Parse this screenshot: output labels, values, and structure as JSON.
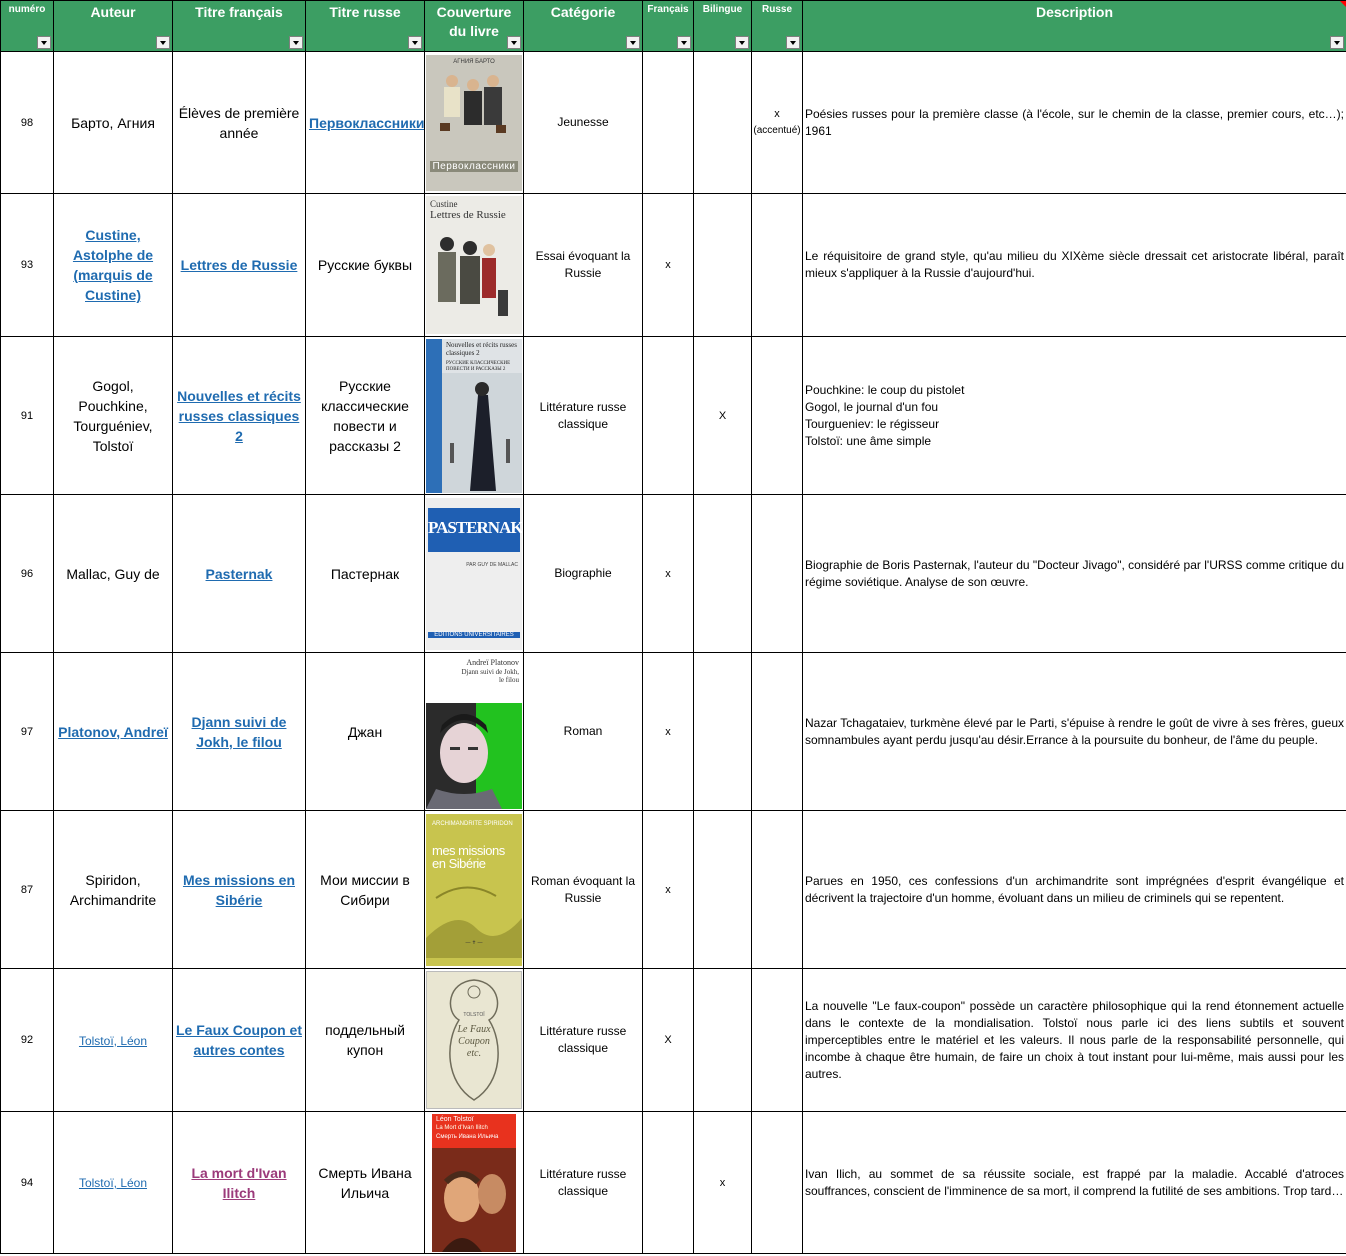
{
  "headers": {
    "numero": "numéro",
    "auteur": "Auteur",
    "titre_fr": "Titre français",
    "titre_ru": "Titre russe",
    "couverture_l1": "Couverture",
    "couverture_l2": "du livre",
    "categorie": "Catégorie",
    "francais": "Français",
    "bilingue": "Bilingue",
    "russe": "Russe",
    "description": "Description"
  },
  "colors": {
    "header_bg": "#3c9e63",
    "link": "#1f6bb0",
    "visited_link": "#9b3a7a"
  },
  "rows": [
    {
      "num": "98",
      "author": "Барто, Агния",
      "author_link": false,
      "title_fr": "Élèves de première année",
      "title_fr_link": false,
      "title_ru": "Первоклассники",
      "title_ru_link": true,
      "cover_text": "Первоклассники",
      "cover_top": "АГНИЯ БАРТО",
      "category": "Jeunesse",
      "fr": "",
      "bi": "",
      "ru": "x",
      "ru2": "(accentué)",
      "desc": "Poésies russes pour la première classe (à l'école, sur le chemin de la classe, premier cours, etc…); 1961"
    },
    {
      "num": "93",
      "author": "Custine, Astolphe de (marquis de Custine)",
      "author_link": true,
      "title_fr": "Lettres de Russie",
      "title_fr_link": true,
      "title_ru": "Русские буквы",
      "title_ru_link": false,
      "cover_text": "Custine",
      "cover_top": "Lettres de Russie",
      "category": "Essai évoquant la Russie",
      "fr": "x",
      "bi": "",
      "ru": "",
      "desc": "Le réquisitoire de grand style, qu'au milieu du XIXème siècle dressait cet aristocrate libéral, paraît mieux s'appliquer à la Russie d'aujourd'hui."
    },
    {
      "num": "91",
      "author": "Gogol, Pouchkine, Tourguéniev, Tolstoï",
      "author_link": false,
      "title_fr": "Nouvelles et récits russes classiques 2",
      "title_fr_link": true,
      "title_ru": "Русские классические повести и рассказы 2",
      "title_ru_link": false,
      "cover_text": "Nouvelles et récits russes classiques 2",
      "cover_top": "РУССКИЕ КЛАССИЧЕСКИЕ ПОВЕСТИ И РАССКАЗЫ 2",
      "category": "Littérature russe classique",
      "fr": "",
      "bi": "X",
      "ru": "",
      "desc_lines": [
        "Pouchkine: le coup du pistolet",
        "Gogol, le journal d'un fou",
        "Tourgueniev: le régisseur",
        "Tolstoï: une âme simple"
      ]
    },
    {
      "num": "96",
      "author": "Mallac, Guy de",
      "author_link": false,
      "title_fr": "Pasternak",
      "title_fr_link": true,
      "title_ru": "Пастернак",
      "title_ru_link": false,
      "cover_text": "PASTERNAK",
      "cover_sub": "PAR GUY DE MALLAC",
      "cover_bottom": "ÉDITIONS UNIVERSITAIRES",
      "category": "Biographie",
      "fr": "x",
      "bi": "",
      "ru": "",
      "desc": "Biographie de Boris Pasternak, l'auteur du \"Docteur Jivago\", considéré par l'URSS comme critique du régime soviétique. Analyse de son œuvre."
    },
    {
      "num": "97",
      "author": "Platonov, Andreï",
      "author_link": true,
      "title_fr": "Djann suivi de Jokh, le filou",
      "title_fr_link": true,
      "title_ru": "Джан",
      "title_ru_link": false,
      "cover_text": "Andreï Platonov",
      "cover_sub": "Djann suivi de Jokh, le filou",
      "category": "Roman",
      "fr": "x",
      "bi": "",
      "ru": "",
      "desc": "Nazar Tchagataiev, turkmène élevé par le Parti, s'épuise à rendre le goût de vivre à ses frères, gueux somnambules ayant perdu jusqu'au désir.Errance à la poursuite du bonheur, de l'âme du peuple."
    },
    {
      "num": "87",
      "author": "Spiridon, Archimandrite",
      "author_link": false,
      "title_fr": "Mes missions en Sibérie",
      "title_fr_link": true,
      "title_ru": "Мои миссии в Сибири",
      "title_ru_link": false,
      "cover_text": "ARCHIMANDRITE SPIRIDON",
      "cover_sub": "mes missions en Sibérie",
      "category": "Roman évoquant la Russie",
      "fr": "x",
      "bi": "",
      "ru": "",
      "desc": "Parues en 1950, ces confessions d'un archimandrite sont imprégnées d'esprit évangélique et décrivent la trajectoire d'un homme, évoluant dans un milieu de criminels qui se repentent."
    },
    {
      "num": "92",
      "author": "Tolstoï, Léon",
      "author_link": true,
      "author_small": true,
      "title_fr": "Le Faux Coupon et autres contes",
      "title_fr_link": true,
      "title_ru": "поддельный купон",
      "title_ru_link": false,
      "cover_text": "Le Faux Coupon etc.",
      "cover_top": "TOLSTOÏ",
      "category": "Littérature russe classique",
      "fr": "X",
      "bi": "",
      "ru": "",
      "desc": "La nouvelle \"Le faux-coupon\" possède un caractère philosophique qui la rend étonnement actuelle dans le contexte de la mondialisation. Tolstoï nous parle ici des liens subtils et souvent imperceptibles entre le matériel et les valeurs. Il nous parle de la responsabilité personnelle, qui incombe à chaque être humain, de faire un choix à tout instant pour lui-même, mais aussi pour les autres."
    },
    {
      "num": "94",
      "author": "Tolstoï, Léon",
      "author_link": true,
      "author_small": true,
      "title_fr": "La mort d'Ivan Ilitch",
      "title_fr_link": true,
      "title_fr_visited": true,
      "title_ru": "Смерть Ивана Ильича",
      "title_ru_link": false,
      "cover_text": "Léon Tolstoï",
      "cover_sub": "La Mort d'Ivan Ilitch",
      "cover_ru": "Смерть Ивана Ильича",
      "category": "Littérature russe classique",
      "fr": "",
      "bi": "x",
      "ru": "",
      "desc": "Ivan Ilich, au sommet de sa réussite sociale, est frappé par la maladie. Accablé d'atroces souffrances, conscient de l'imminence de sa mort, il comprend la futilité de ses ambitions. Trop tard…"
    }
  ]
}
